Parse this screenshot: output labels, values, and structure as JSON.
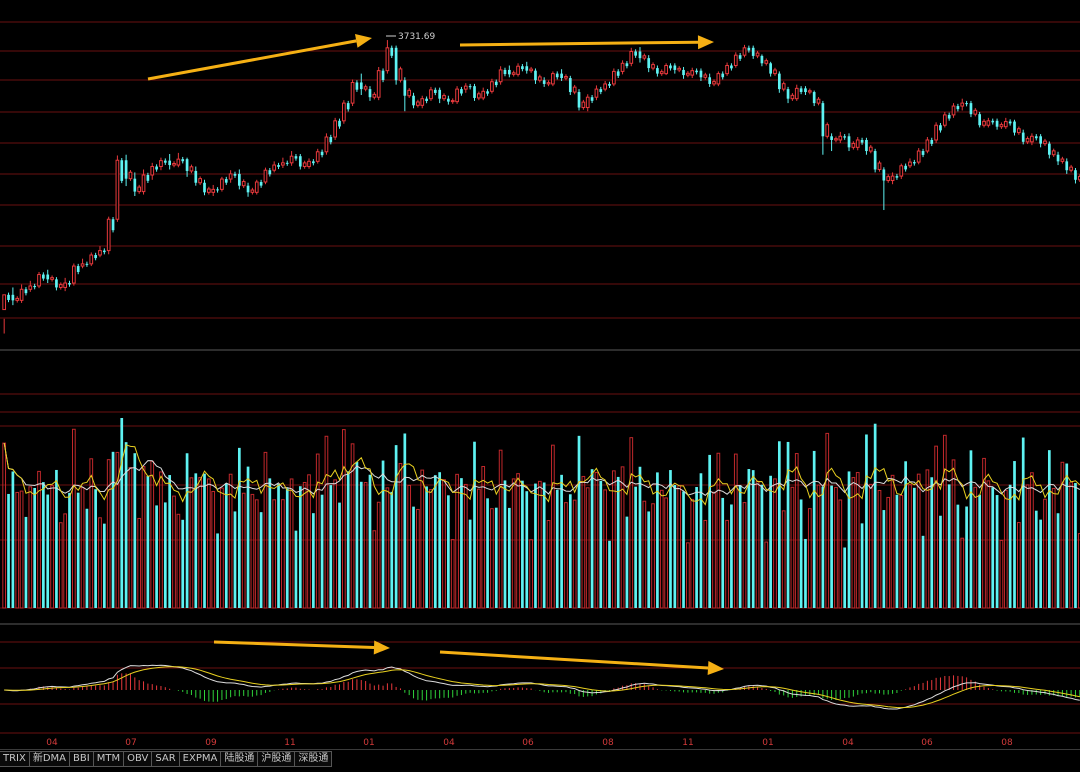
{
  "colors": {
    "background": "#000000",
    "up": "#e8393c",
    "up_volume": "#c1282b",
    "down": "#5ef2f2",
    "grid": "#6a0f0f",
    "ma_white": "#dddddd",
    "ma_yellow": "#e8d020",
    "annotation_arrow": "#f5b014",
    "macd_positive": "#e8393c",
    "macd_negative": "#2fd23a"
  },
  "price_chart": {
    "high_label": "3731.69",
    "ymin": 2950,
    "ymax": 3780
  },
  "x_axis_labels": [
    "04",
    "07",
    "09",
    "11",
    "01",
    "04",
    "06",
    "08",
    "11",
    "01",
    "04",
    "06",
    "08"
  ],
  "indicator_tabs": [
    "TRIX",
    "新DMA",
    "BBI",
    "MTM",
    "OBV",
    "SAR",
    "EXPMA",
    "陆股通",
    "沪股通",
    "深股通"
  ],
  "chart_data": {
    "type": "candlestick",
    "seed": [
      [
        3000,
        3040,
        2975,
        2935
      ],
      [
        3040,
        3025,
        3060,
        3012
      ],
      [
        3025,
        3055,
        3068,
        3018
      ],
      [
        3055,
        3064,
        3078,
        3048
      ],
      [
        3064,
        3095,
        3102,
        3058
      ],
      [
        3095,
        3082,
        3108,
        3072
      ],
      [
        3082,
        3060,
        3088,
        3052
      ],
      [
        3060,
        3072,
        3086,
        3050
      ],
      [
        3072,
        3118,
        3125,
        3065
      ],
      [
        3118,
        3124,
        3138,
        3112
      ],
      [
        3124,
        3148,
        3155,
        3118
      ],
      [
        3148,
        3160,
        3172,
        3142
      ],
      [
        3160,
        3245,
        3252,
        3150
      ],
      [
        3245,
        3405,
        3418,
        3238
      ],
      [
        3405,
        3355,
        3420,
        3335
      ],
      [
        3355,
        3320,
        3372,
        3308
      ],
      [
        3320,
        3365,
        3380,
        3312
      ],
      [
        3365,
        3388,
        3398,
        3352
      ],
      [
        3388,
        3404,
        3412,
        3378
      ],
      [
        3404,
        3392,
        3422,
        3380
      ],
      [
        3392,
        3408,
        3425,
        3386
      ],
      [
        3408,
        3376,
        3412,
        3360
      ],
      [
        3376,
        3344,
        3388,
        3336
      ],
      [
        3344,
        3318,
        3352,
        3310
      ],
      [
        3318,
        3326,
        3338,
        3308
      ],
      [
        3326,
        3354,
        3360,
        3320
      ],
      [
        3354,
        3368,
        3378,
        3344
      ],
      [
        3368,
        3336,
        3380,
        3326
      ],
      [
        3336,
        3318,
        3344,
        3306
      ],
      [
        3318,
        3346,
        3352,
        3312
      ],
      [
        3346,
        3378,
        3385,
        3340
      ],
      [
        3378,
        3392,
        3402,
        3372
      ],
      [
        3392,
        3398,
        3412,
        3384
      ],
      [
        3398,
        3416,
        3430,
        3390
      ],
      [
        3416,
        3388,
        3422,
        3380
      ],
      [
        3388,
        3402,
        3410,
        3382
      ],
      [
        3402,
        3428,
        3436,
        3396
      ],
      [
        3428,
        3468,
        3478,
        3420
      ],
      [
        3468,
        3512,
        3520,
        3460
      ],
      [
        3512,
        3560,
        3568,
        3504
      ],
      [
        3560,
        3616,
        3624,
        3552
      ],
      [
        3616,
        3598,
        3640,
        3582
      ],
      [
        3598,
        3576,
        3606,
        3566
      ],
      [
        3576,
        3648,
        3658,
        3568
      ],
      [
        3648,
        3710,
        3731,
        3640
      ],
      [
        3710,
        3622,
        3716,
        3610
      ],
      [
        3622,
        3580,
        3630,
        3538
      ],
      [
        3580,
        3554,
        3588,
        3546
      ],
      [
        3554,
        3572,
        3580,
        3546
      ],
      [
        3572,
        3596,
        3604,
        3566
      ],
      [
        3596,
        3572,
        3602,
        3560
      ],
      [
        3572,
        3564,
        3580,
        3556
      ],
      [
        3564,
        3598,
        3606,
        3558
      ],
      [
        3598,
        3606,
        3614,
        3588
      ],
      [
        3606,
        3574,
        3612,
        3566
      ],
      [
        3574,
        3592,
        3602,
        3568
      ],
      [
        3592,
        3618,
        3626,
        3586
      ],
      [
        3618,
        3650,
        3660,
        3610
      ],
      [
        3650,
        3638,
        3662,
        3630
      ],
      [
        3638,
        3660,
        3668,
        3632
      ],
      [
        3660,
        3648,
        3672,
        3640
      ],
      [
        3648,
        3622,
        3654,
        3612
      ],
      [
        3622,
        3612,
        3630,
        3604
      ],
      [
        3612,
        3640,
        3646,
        3606
      ],
      [
        3640,
        3628,
        3652,
        3620
      ],
      [
        3628,
        3590,
        3634,
        3582
      ],
      [
        3590,
        3548,
        3598,
        3540
      ],
      [
        3548,
        3576,
        3584,
        3538
      ],
      [
        3576,
        3598,
        3608,
        3568
      ],
      [
        3598,
        3612,
        3620,
        3592
      ],
      [
        3612,
        3646,
        3654,
        3606
      ],
      [
        3646,
        3668,
        3676,
        3638
      ],
      [
        3668,
        3700,
        3710,
        3660
      ],
      [
        3700,
        3682,
        3712,
        3670
      ],
      [
        3682,
        3655,
        3690,
        3644
      ],
      [
        3655,
        3640,
        3662,
        3632
      ],
      [
        3640,
        3662,
        3668,
        3636
      ],
      [
        3662,
        3650,
        3668,
        3640
      ],
      [
        3650,
        3636,
        3658,
        3626
      ],
      [
        3636,
        3648,
        3656,
        3628
      ],
      [
        3648,
        3630,
        3654,
        3620
      ],
      [
        3630,
        3612,
        3640,
        3604
      ],
      [
        3612,
        3640,
        3646,
        3606
      ],
      [
        3640,
        3662,
        3670,
        3634
      ],
      [
        3662,
        3690,
        3698,
        3656
      ],
      [
        3690,
        3710,
        3718,
        3684
      ],
      [
        3710,
        3688,
        3716,
        3680
      ],
      [
        3688,
        3668,
        3692,
        3660
      ],
      [
        3668,
        3640,
        3672,
        3632
      ],
      [
        3640,
        3598,
        3646,
        3588
      ],
      [
        3598,
        3572,
        3604,
        3560
      ],
      [
        3572,
        3600,
        3610,
        3566
      ],
      [
        3600,
        3590,
        3606,
        3582
      ],
      [
        3590,
        3560,
        3594,
        3552
      ],
      [
        3560,
        3470,
        3566,
        3420
      ],
      [
        3470,
        3460,
        3478,
        3430
      ],
      [
        3460,
        3470,
        3482,
        3452
      ],
      [
        3470,
        3440,
        3478,
        3430
      ],
      [
        3440,
        3460,
        3468,
        3432
      ],
      [
        3460,
        3430,
        3466,
        3420
      ],
      [
        3430,
        3380,
        3436,
        3372
      ],
      [
        3380,
        3350,
        3386,
        3270
      ],
      [
        3350,
        3362,
        3372,
        3340
      ],
      [
        3362,
        3390,
        3396,
        3354
      ],
      [
        3390,
        3400,
        3410,
        3384
      ],
      [
        3400,
        3430,
        3438,
        3394
      ],
      [
        3430,
        3460,
        3468,
        3424
      ],
      [
        3460,
        3500,
        3508,
        3452
      ],
      [
        3500,
        3528,
        3536,
        3494
      ],
      [
        3528,
        3552,
        3560,
        3520
      ],
      [
        3552,
        3560,
        3572,
        3540
      ],
      [
        3560,
        3530,
        3566,
        3522
      ],
      [
        3530,
        3500,
        3536,
        3494
      ],
      [
        3500,
        3512,
        3520,
        3494
      ],
      [
        3512,
        3496,
        3518,
        3488
      ],
      [
        3496,
        3510,
        3520,
        3490
      ],
      [
        3510,
        3480,
        3515,
        3472
      ],
      [
        3480,
        3455,
        3488,
        3448
      ],
      [
        3455,
        3470,
        3478,
        3446
      ],
      [
        3470,
        3450,
        3476,
        3440
      ],
      [
        3450,
        3420,
        3456,
        3410
      ],
      [
        3420,
        3402,
        3428,
        3392
      ],
      [
        3402,
        3378,
        3410,
        3368
      ],
      [
        3378,
        3352,
        3384,
        3342
      ]
    ]
  }
}
